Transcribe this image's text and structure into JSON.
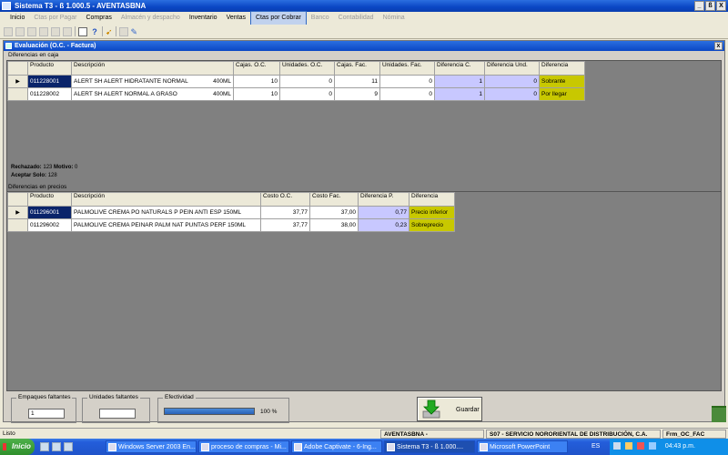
{
  "window": {
    "title": "Sistema T3 - ß 1.000.5 - AVENTASBNA",
    "min": "_",
    "max": "ß",
    "close": "X"
  },
  "menu": [
    {
      "label": "Inicio",
      "enabled": true
    },
    {
      "label": "Ctas por Pagar",
      "enabled": false
    },
    {
      "label": "Compras",
      "enabled": true
    },
    {
      "label": "Almacén y despacho",
      "enabled": false
    },
    {
      "label": "Inventario",
      "enabled": true
    },
    {
      "label": "Ventas",
      "enabled": true
    },
    {
      "label": "Ctas por Cobrar",
      "enabled": true,
      "active": true
    },
    {
      "label": "Banco",
      "enabled": false
    },
    {
      "label": "Contabilidad",
      "enabled": false
    },
    {
      "label": "Nómina",
      "enabled": false
    }
  ],
  "child": {
    "title": "Evaluación (O.C. - Factura)",
    "close": "x"
  },
  "caja": {
    "label": "Diferencias en caja",
    "headers": [
      "Producto",
      "Descripción",
      "Cajas. O.C.",
      "Unidades. O.C.",
      "Cajas. Fac.",
      "Unidades. Fac.",
      "Diferencia C.",
      "Diferencia Und.",
      "Diferencia"
    ],
    "rows": [
      {
        "ind": "▶",
        "producto": "011228001",
        "desc": "ALERT SH ALERT HIDRATANTE NORMAL",
        "size": "400ML",
        "cajas_oc": "10",
        "und_oc": "0",
        "cajas_fac": "11",
        "und_fac": "0",
        "dif_c": "1",
        "dif_und": "0",
        "dif": "Sobrante"
      },
      {
        "ind": "",
        "producto": "011228002",
        "desc": "ALERT SH ALERT NORMAL A GRASO",
        "size": "400ML",
        "cajas_oc": "10",
        "und_oc": "0",
        "cajas_fac": "9",
        "und_fac": "0",
        "dif_c": "1",
        "dif_und": "0",
        "dif": "Por llegar"
      }
    ]
  },
  "info": {
    "rechazado_label": "Rechazado:",
    "rechazado_val": "123",
    "motivo_label": "Motivo:",
    "motivo_val": "0",
    "aceptar_label": "Aceptar Solo:",
    "aceptar_val": "128"
  },
  "precios": {
    "label": "Diferencias en precios",
    "headers": [
      "Producto",
      "Descripción",
      "Costo O.C.",
      "Costo Fac.",
      "Diferencia P.",
      "Diferencia"
    ],
    "rows": [
      {
        "ind": "▶",
        "producto": "011296001",
        "desc": "PALMOLIVE CREMA PO NATURALS P PEIN ANTI ESP 150ML",
        "costo_oc": "37,77",
        "costo_fac": "37,00",
        "dif_p": "0,77",
        "dif": "Precio inferior"
      },
      {
        "ind": "",
        "producto": "011296002",
        "desc": "PALMOLIVE CREMA PEINAR PALM NAT PUNTAS PERF 150ML",
        "costo_oc": "37,77",
        "costo_fac": "38,00",
        "dif_p": "0,23",
        "dif": "Sobreprecio"
      }
    ]
  },
  "bottom": {
    "empaques_label": "Empaques faltantes",
    "empaques_val": "1",
    "unidades_label": "Unidades faltantes",
    "unidades_val": "",
    "efectividad_label": "Efectividad",
    "efectividad_pct": "100 %",
    "efectividad_fraction": 1.0,
    "guardar_label": "Guardar"
  },
  "status": {
    "text": "Listo",
    "user": "AVENTASBNA - CARMEN.NORIEGA",
    "company": "S07 - SERVICIO NORORIENTAL DE DISTRIBUCIÓN, C.A.",
    "form": "Frm_OC_FAC"
  },
  "taskbar": {
    "start": "Inicio",
    "tasks": [
      "Windows Server 2003 En...",
      "proceso de compras - Mi...",
      "Adobe Captivate - 6-Ing...",
      "Sistema T3 - ß 1.000....",
      "Microsoft PowerPoint"
    ],
    "lang": "ES",
    "clock": "04:43 p.m."
  },
  "colors": {
    "accent": "#0a46c4",
    "lavender": "#c8c8ff",
    "olive": "#c8c800",
    "selected": "#0a246a"
  }
}
